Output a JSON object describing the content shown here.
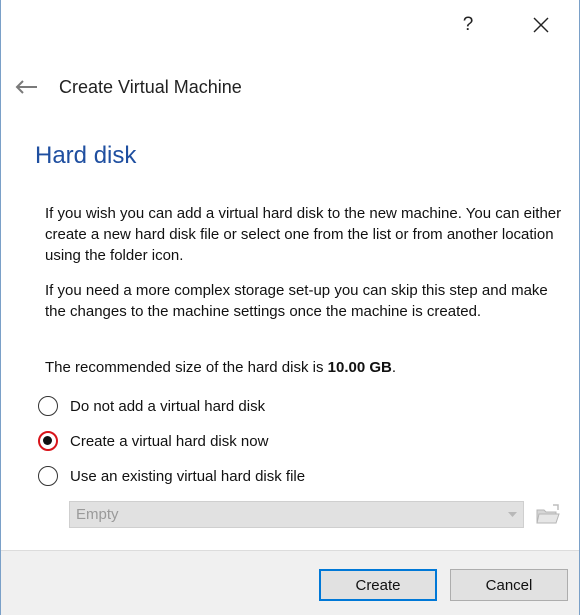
{
  "titlebar": {
    "help_glyph": "?",
    "close_glyph": "✕"
  },
  "header": {
    "title": "Create Virtual Machine",
    "back_icon": "arrow-left-icon"
  },
  "page": {
    "title": "Hard disk",
    "paragraph1": "If you wish you can add a virtual hard disk to the new machine. You can either create a new hard disk file or select one from the list or from another location using the folder icon.",
    "paragraph2": "If you need a more complex storage set-up you can skip this step and make the changes to the machine settings once the machine is created.",
    "recommended_prefix": "The recommended size of the hard disk is ",
    "recommended_size": "10.00 GB",
    "recommended_suffix": "."
  },
  "options": [
    {
      "label": "Do not add a virtual hard disk",
      "selected": false
    },
    {
      "label": "Create a virtual hard disk now",
      "selected": true
    },
    {
      "label": "Use an existing virtual hard disk file",
      "selected": false
    }
  ],
  "disk_selector": {
    "value": "Empty",
    "enabled": false,
    "folder_icon": "folder-icon"
  },
  "buttons": {
    "create": "Create",
    "cancel": "Cancel"
  },
  "colors": {
    "title_blue": "#1f4fa0",
    "selected_highlight": "#d8141a",
    "default_button_border": "#0078d7"
  }
}
